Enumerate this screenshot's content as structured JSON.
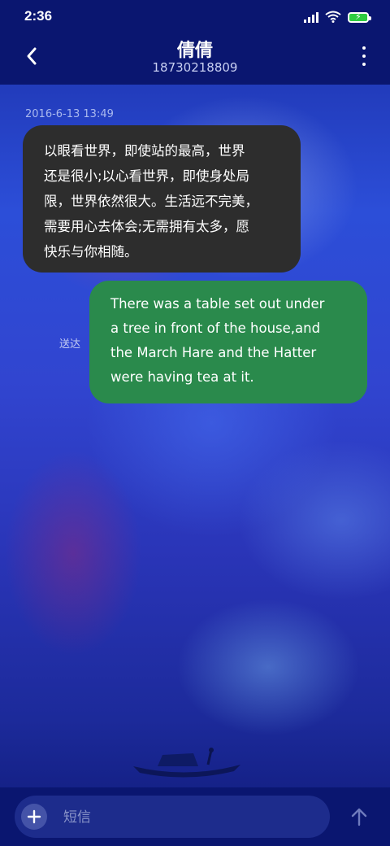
{
  "status_bar": {
    "time": "2:36",
    "icons": [
      "signal-icon",
      "wifi-icon",
      "battery-charging-icon"
    ]
  },
  "header": {
    "contact_name": "倩倩",
    "phone_number": "18730218809",
    "back_icon": "back-arrow-icon",
    "menu_icon": "more-vertical-icon"
  },
  "messages": [
    {
      "direction": "incoming",
      "timestamp": "2016-6-13 13:49",
      "text": "以眼看世界，即使站的最高，世界\n还是很小;以心看世界，即使身处局\n限，世界依然很大。生活远不完美，\n需要用心去体会;无需拥有太多，愿\n快乐与你相随。"
    },
    {
      "direction": "outgoing",
      "status": "送达",
      "text": "There was a table set out under\na tree in front of the house,and\nthe March Hare and the Hatter\nwere having tea at it."
    }
  ],
  "composer": {
    "placeholder": "短信",
    "add_icon": "plus-icon",
    "send_icon": "arrow-up-icon"
  },
  "colors": {
    "bar_background": "#0a1670",
    "incoming_bubble": "#2d2d2d",
    "outgoing_bubble": "#2a8a4c"
  }
}
